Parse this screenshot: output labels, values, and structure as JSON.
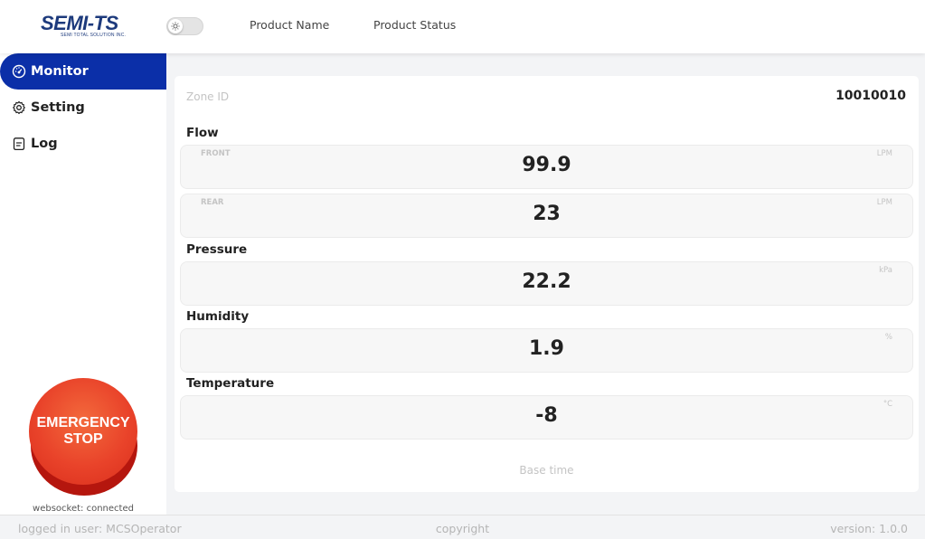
{
  "header": {
    "logo_text": "SEMI-TS",
    "logo_subtext": "SEMI TOTAL SOLUTION INC.",
    "theme_toggle_icon": "sun-icon",
    "nav": [
      "Product Name",
      "Product Status"
    ]
  },
  "sidebar": {
    "items": [
      {
        "label": "Monitor",
        "icon": "dashboard-icon",
        "active": true
      },
      {
        "label": "Setting",
        "icon": "gear-icon",
        "active": false
      },
      {
        "label": "Log",
        "icon": "document-icon",
        "active": false
      }
    ],
    "emergency_stop": {
      "line1": "EMERGENCY",
      "line2": "STOP"
    },
    "websocket_status": "websocket: connected"
  },
  "monitor": {
    "zone_label": "Zone ID",
    "zone_value": "10010010",
    "flow": {
      "title": "Flow",
      "front": {
        "tag": "FRONT",
        "value": "99.9",
        "unit": "LPM"
      },
      "rear": {
        "tag": "REAR",
        "value": "23",
        "unit": "LPM"
      }
    },
    "pressure": {
      "title": "Pressure",
      "value": "22.2",
      "unit": "kPa"
    },
    "humidity": {
      "title": "Humidity",
      "value": "1.9",
      "unit": "%"
    },
    "temperature": {
      "title": "Temperature",
      "value": "-8",
      "unit": "°C"
    },
    "base_time_label": "Base time"
  },
  "footer": {
    "user": "logged in user: MCSOperator",
    "copyright": "copyright",
    "version": "version: 1.0.0"
  },
  "colors": {
    "accent": "#0b2fa8",
    "logo": "#1d3a7c",
    "emergency": "#e9432a",
    "muted_text": "#c4c4c4"
  }
}
